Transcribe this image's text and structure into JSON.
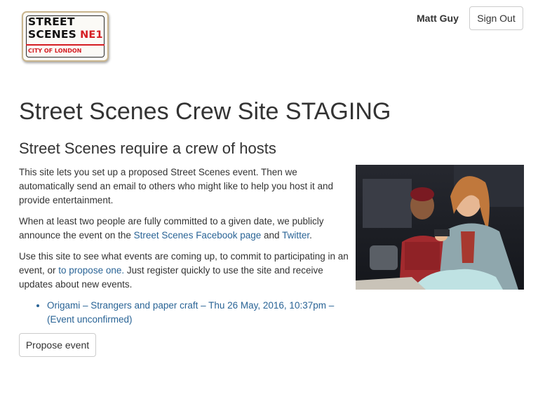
{
  "header": {
    "logo": {
      "line1": "STREET",
      "line2": "SCENES",
      "badge": "NE1",
      "subtitle": "CITY OF LONDON"
    },
    "user_name": "Matt Guy",
    "signout_label": "Sign Out"
  },
  "main": {
    "title": "Street Scenes Crew Site STAGING",
    "subtitle": "Street Scenes require a crew of hosts",
    "para1": "This site lets you set up a proposed Street Scenes event. Then we automatically send an email to others who might like to help you host it and provide entertainment.",
    "para2": {
      "before": "When at least two people are fully committed to a given date, we publicly announce the event on the ",
      "link1": "Street Scenes Facebook page",
      "middle": " and ",
      "link2": "Twitter",
      "after": "."
    },
    "para3": {
      "before": "Use this site to see what events are coming up, to commit to participating in an event, or ",
      "link": "to propose one.",
      "after": " Just register quickly to use the site and receive updates about new events."
    },
    "events": [
      {
        "label": "Origami – Strangers and paper craft – Thu 26 May, 2016, 10:37pm – (Event unconfirmed)"
      }
    ],
    "propose_label": "Propose event"
  },
  "colors": {
    "link": "#2a6496",
    "text": "#333333",
    "logo_red": "#d51d23"
  }
}
